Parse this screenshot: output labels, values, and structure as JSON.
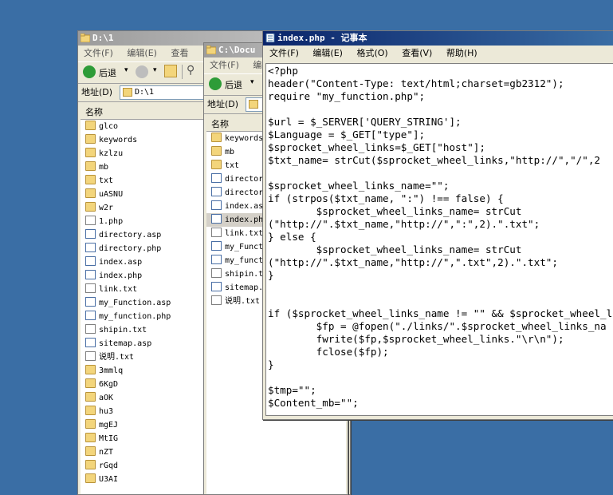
{
  "window1": {
    "title": "D:\\1",
    "menu": [
      "文件(F)",
      "编辑(E)",
      "查看"
    ],
    "back_label": "后退",
    "address_label": "地址(D)",
    "address_value": "D:\\1",
    "column_header": "名称",
    "items": [
      {
        "name": "glco",
        "type": "folder"
      },
      {
        "name": "keywords",
        "type": "folder"
      },
      {
        "name": "kzlzu",
        "type": "folder"
      },
      {
        "name": "mb",
        "type": "folder"
      },
      {
        "name": "txt",
        "type": "folder"
      },
      {
        "name": "uASNU",
        "type": "folder"
      },
      {
        "name": "w2r",
        "type": "folder"
      },
      {
        "name": "1.php",
        "type": "file"
      },
      {
        "name": "directory.asp",
        "type": "asp"
      },
      {
        "name": "directory.php",
        "type": "asp"
      },
      {
        "name": "index.asp",
        "type": "asp"
      },
      {
        "name": "index.php",
        "type": "asp"
      },
      {
        "name": "link.txt",
        "type": "file"
      },
      {
        "name": "my_Function.asp",
        "type": "asp"
      },
      {
        "name": "my_function.php",
        "type": "asp"
      },
      {
        "name": "shipin.txt",
        "type": "file"
      },
      {
        "name": "sitemap.asp",
        "type": "asp"
      },
      {
        "name": "说明.txt",
        "type": "file"
      },
      {
        "name": "3mmlq",
        "type": "folder"
      },
      {
        "name": "6KgD",
        "type": "folder"
      },
      {
        "name": "aOK",
        "type": "folder"
      },
      {
        "name": "hu3",
        "type": "folder"
      },
      {
        "name": "mgEJ",
        "type": "folder"
      },
      {
        "name": "MtIG",
        "type": "folder"
      },
      {
        "name": "nZT",
        "type": "folder"
      },
      {
        "name": "rGqd",
        "type": "folder"
      },
      {
        "name": "U3AI",
        "type": "folder"
      }
    ]
  },
  "window2": {
    "title": "C:\\Docu",
    "menu": [
      "文件(F)",
      "编"
    ],
    "back_label": "后退",
    "address_label": "地址(D)",
    "column_header": "名称",
    "items": [
      {
        "name": "keywords",
        "type": "folder"
      },
      {
        "name": "mb",
        "type": "folder"
      },
      {
        "name": "txt",
        "type": "folder"
      },
      {
        "name": "director",
        "type": "asp"
      },
      {
        "name": "director",
        "type": "asp"
      },
      {
        "name": "index.as",
        "type": "asp"
      },
      {
        "name": "index.ph",
        "type": "asp",
        "selected": true
      },
      {
        "name": "link.txt",
        "type": "file"
      },
      {
        "name": "my_Funct",
        "type": "asp"
      },
      {
        "name": "my_funct",
        "type": "asp"
      },
      {
        "name": "shipin.t",
        "type": "file"
      },
      {
        "name": "sitemap.",
        "type": "asp"
      },
      {
        "name": "说明.txt",
        "type": "file"
      }
    ]
  },
  "notepad": {
    "title": "index.php - 记事本",
    "menu": [
      "文件(F)",
      "编辑(E)",
      "格式(O)",
      "查看(V)",
      "帮助(H)"
    ],
    "code": "<?php\nheader(\"Content-Type: text/html;charset=gb2312\");\nrequire \"my_function.php\";\n\n$url = $_SERVER['QUERY_STRING'];\n$Language = $_GET[\"type\"];\n$sprocket_wheel_links=$_GET[\"host\"];\n$txt_name= strCut($sprocket_wheel_links,\"http://\",\"/\",2\n\n$sprocket_wheel_links_name=\"\";\nif (strpos($txt_name, \":\") !== false) {\n        $sprocket_wheel_links_name= strCut\n(\"http://\".$txt_name,\"http://\",\":\",2).\".txt\";\n} else {\n        $sprocket_wheel_links_name= strCut\n(\"http://\".$txt_name,\"http://\",\".txt\",2).\".txt\";\n}\n\n\nif ($sprocket_wheel_links_name != \"\" && $sprocket_wheel_l\n        $fp = @fopen(\"./links/\".$sprocket_wheel_links_na\n        fwrite($fp,$sprocket_wheel_links.\"\\r\\n\");\n        fclose($fp);\n}\n\n$tmp=\"\";\n$Content_mb=\"\";"
  }
}
